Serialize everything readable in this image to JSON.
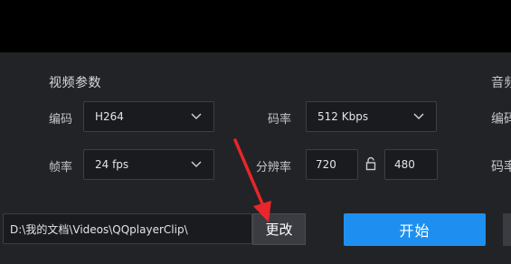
{
  "video_section": {
    "title": "视频参数",
    "codec_label": "编码",
    "codec_value": "H264",
    "bitrate_label": "码率",
    "bitrate_value": "512 Kbps",
    "framerate_label": "帧率",
    "framerate_value": "24 fps",
    "resolution_label": "分辨率",
    "width_value": "720",
    "height_value": "480"
  },
  "audio_section": {
    "title_partial": "音频",
    "codec_label_partial": "编码",
    "bitrate_label_partial": "码率"
  },
  "output": {
    "path_value": "D:\\我的文档\\Videos\\QQplayerClip\\",
    "change_label": "更改",
    "start_label": "开始"
  },
  "colors": {
    "accent": "#1e8ff0",
    "panel_bg": "#222326",
    "arrow": "#e8262b"
  }
}
